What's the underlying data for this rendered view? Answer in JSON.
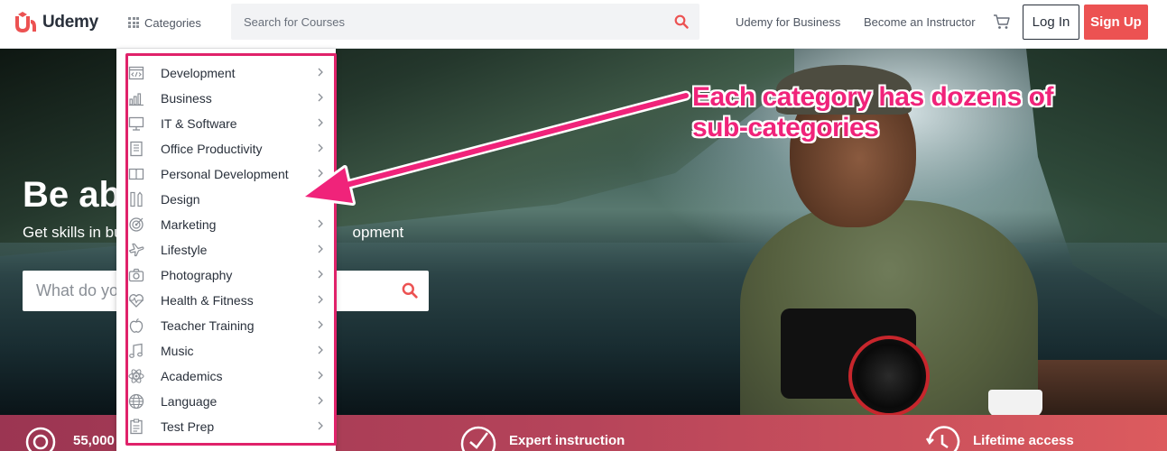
{
  "header": {
    "logo_text": "Udemy",
    "categories_label": "Categories",
    "search_placeholder": "Search for Courses",
    "nav": {
      "business": "Udemy for Business",
      "instructor": "Become an Instructor"
    },
    "login_label": "Log In",
    "signup_label": "Sign Up",
    "accent_color": "#ec5252"
  },
  "hero": {
    "title_visible": "Be ab",
    "subtitle_left": "Get skills in bu",
    "subtitle_right": "opment",
    "search_placeholder_visible": "What do yo"
  },
  "categories": [
    {
      "label": "Development",
      "icon": "code-window-icon",
      "has_submenu": true
    },
    {
      "label": "Business",
      "icon": "bar-chart-icon",
      "has_submenu": true
    },
    {
      "label": "IT & Software",
      "icon": "monitor-icon",
      "has_submenu": true
    },
    {
      "label": "Office Productivity",
      "icon": "document-list-icon",
      "has_submenu": true
    },
    {
      "label": "Personal Development",
      "icon": "open-book-icon",
      "has_submenu": true
    },
    {
      "label": "Design",
      "icon": "pencil-ruler-icon",
      "has_submenu": false
    },
    {
      "label": "Marketing",
      "icon": "target-icon",
      "has_submenu": true
    },
    {
      "label": "Lifestyle",
      "icon": "airplane-icon",
      "has_submenu": true
    },
    {
      "label": "Photography",
      "icon": "camera-icon",
      "has_submenu": true
    },
    {
      "label": "Health & Fitness",
      "icon": "heart-pulse-icon",
      "has_submenu": true
    },
    {
      "label": "Teacher Training",
      "icon": "apple-icon",
      "has_submenu": true
    },
    {
      "label": "Music",
      "icon": "music-note-icon",
      "has_submenu": true
    },
    {
      "label": "Academics",
      "icon": "atom-icon",
      "has_submenu": true
    },
    {
      "label": "Language",
      "icon": "globe-icon",
      "has_submenu": true
    },
    {
      "label": "Test Prep",
      "icon": "clipboard-icon",
      "has_submenu": true
    }
  ],
  "band": {
    "item1": "55,000",
    "item2": "Expert instruction",
    "item3": "Lifetime access"
  },
  "annotation": {
    "line1": "Each category has dozens of",
    "line2": "sub-categories",
    "color": "#f0237a"
  }
}
